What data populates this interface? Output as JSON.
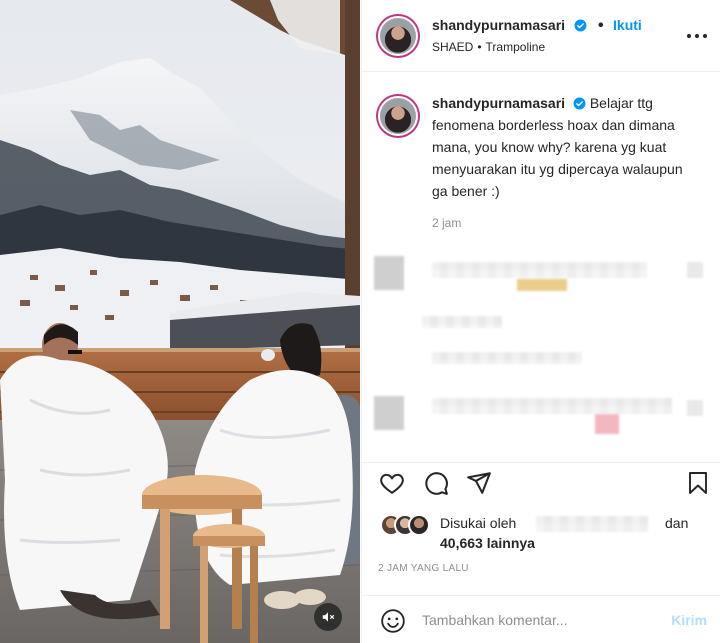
{
  "post": {
    "username": "shandypurnamasari",
    "follow_label": "Ikuti",
    "follow_separator": "•",
    "audio": {
      "artist": "SHAED",
      "separator": "•",
      "track": "Trampoline"
    },
    "caption": {
      "username": "shandypurnamasari",
      "text": "Belajar ttg fenomena borderless hoax dan dimana mana, you know why? karena yg kuat menyuarakan itu yg dipercaya walaupun ga bener :)",
      "time": "2 jam"
    },
    "likes": {
      "prefix": "Disukai oleh",
      "suffix": "dan",
      "count_label": "40,663 lainnya"
    },
    "time_ago": "2 JAM YANG LALU",
    "comment": {
      "placeholder": "Tambahkan komentar...",
      "send_label": "Kirim"
    }
  },
  "icons": {
    "verified": "verified-badge-icon",
    "more": "more-options-icon",
    "like": "heart-icon",
    "comment": "comment-icon",
    "share": "share-icon",
    "save": "bookmark-icon",
    "emoji": "emoji-icon",
    "mute": "mute-icon"
  },
  "colors": {
    "accent": "#0095f6",
    "verified": "#0095f6",
    "muted_text": "#8e8e8e",
    "send_disabled": "#b2dffc"
  }
}
